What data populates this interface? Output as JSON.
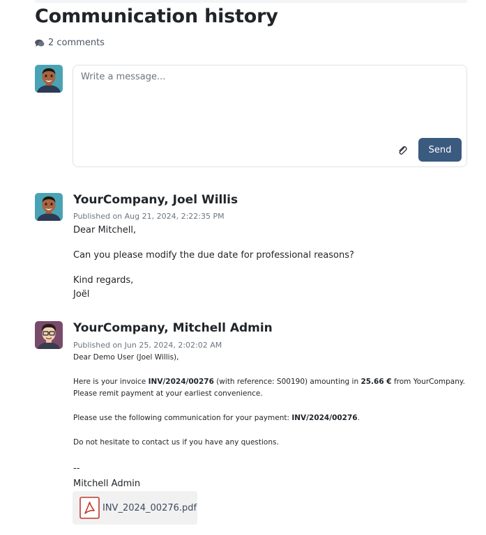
{
  "page": {
    "title": "Communication history",
    "comment_count": "2 comments"
  },
  "composer": {
    "placeholder": "Write a message...",
    "send_label": "Send"
  },
  "messages": [
    {
      "author": "YourCompany, Joel Willis",
      "published": "Published on Aug 21, 2024, 2:22:35 PM",
      "greeting": "Dear Mitchell,",
      "body": "Can you please modify the due date for professional reasons?",
      "closing": "Kind regards,",
      "signature": "Joël"
    },
    {
      "author": "YourCompany, Mitchell Admin",
      "published": "Published on Jun 25, 2024, 2:02:02 AM",
      "greeting": "Dear Demo User (Joel Willis),",
      "invoice_pre": "Here is your invoice ",
      "invoice_number": "INV/2024/00276",
      "invoice_ref_pre": " (with reference: S00190) amounting in ",
      "amount": "25.66 €",
      "invoice_post": " from YourCompany.",
      "remit": "Please remit payment at your earliest convenience.",
      "comm_pre": "Please use the following communication for your payment: ",
      "comm_ref": "INV/2024/00276",
      "comm_post": ".",
      "contact": "Do not hesitate to contact us if you have any questions.",
      "dashes": "--",
      "signature": "Mitchell Admin",
      "attachment": "INV_2024_00276.pdf"
    }
  ],
  "icons": {
    "comments": "comments-icon",
    "attach": "paperclip-icon",
    "file": "pdf-file-icon"
  },
  "colors": {
    "send_button": "#3b5a7f",
    "pdf_icon": "#c0392b"
  }
}
